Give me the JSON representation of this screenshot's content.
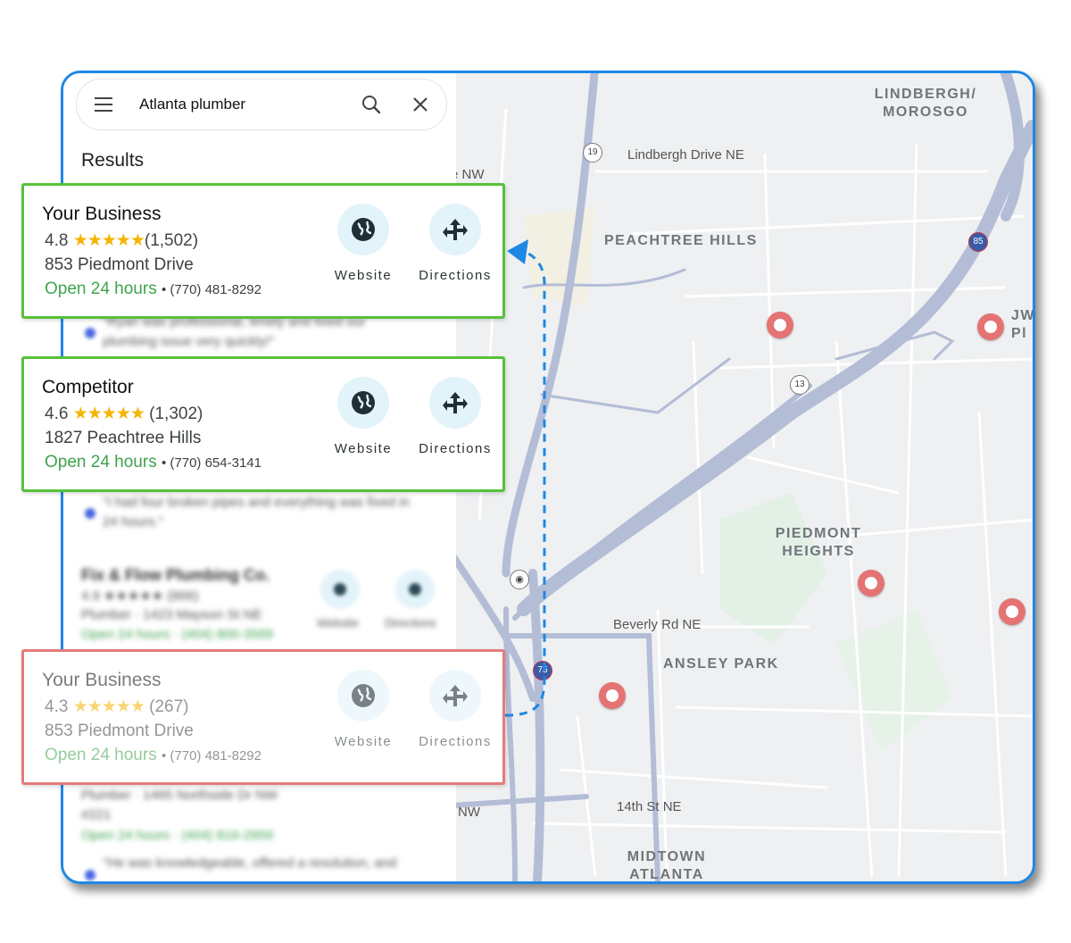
{
  "search": {
    "query": "Atlanta plumber"
  },
  "sidebar": {
    "results_heading": "Results"
  },
  "listings": [
    {
      "name": "Your Business",
      "rating": "4.8",
      "stars": "★★★★★",
      "reviews": "(1,502)",
      "address": "853 Piedmont Drive",
      "hours": "Open 24 hours",
      "phone": "(770) 481-8292",
      "website_label": "Website",
      "directions_label": "Directions"
    },
    {
      "name": "Competitor",
      "rating": "4.6",
      "stars": "★★★★★",
      "reviews": "(1,302)",
      "address": "1827 Peachtree Hills",
      "hours": "Open 24 hours",
      "phone": "(770) 654-3141",
      "website_label": "Website",
      "directions_label": "Directions"
    },
    {
      "name": "Your Business",
      "rating": "4.3",
      "stars": "★★★★★",
      "reviews": "(267)",
      "address": "853 Piedmont Drive",
      "hours": "Open 24 hours",
      "phone": "(770) 481-8292",
      "website_label": "Website",
      "directions_label": "Directions"
    }
  ],
  "blurred": {
    "review1_a": "\"Ryan was professional, timely and fixed our",
    "review1_b": "plumbing issue very quickly!\"",
    "review2_a": "\"I had four broken pipes and everything was fixed in",
    "review2_b": "24 hours.\"",
    "listing_name": "Fix & Flow Plumbing Co.",
    "listing_rating": "4.9 ★★★★★ (866)",
    "listing_address": "Plumber · 1423 Mayson St NE",
    "listing_hours": "Open 24 hours · (404) 800-3569",
    "listing_website": "Website",
    "listing_directions": "Directions",
    "listing2_address_a": "Plumber · 1465 Northside Dr NW",
    "listing2_address_b": "#221",
    "listing2_hours": "Open 24 hours · (404) 816-2959",
    "review3": "\"He was knowledgeable, offered a resolution, and"
  },
  "map": {
    "labels": {
      "lindbergh": "LINDBERGH/\nMOROSGO",
      "lindbergh_drive": "Lindbergh Drive NE",
      "peachtree_hills": "PEACHTREE HILLS",
      "piedmont_heights": "PIEDMONT\nHEIGHTS",
      "beverly": "Beverly Rd NE",
      "ansley": "ANSLEY PARK",
      "fourteenth": "14th St NE",
      "midtown": "MIDTOWN\nATLANTA",
      "edge_nw": "e NW",
      "edge_nw2": "NW",
      "edge_jw": "JW\nPl"
    },
    "shields": {
      "us19": "19",
      "i85": "85",
      "ga13": "13",
      "i75": "75"
    }
  },
  "colors": {
    "frame": "#1e88e5",
    "highlight_border": "#56c23a",
    "faded_border": "#e57b7b",
    "open_text": "#3fa34d",
    "star": "#f4b400",
    "pin": "#e57373"
  }
}
